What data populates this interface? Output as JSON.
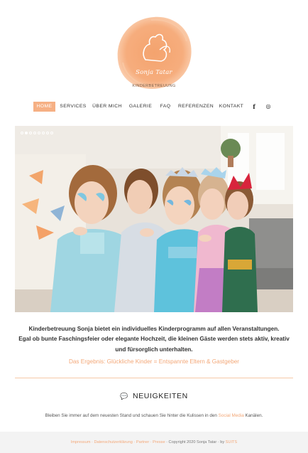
{
  "logo": {
    "script_text": "Sonja Tatar",
    "subtitle": "KINDERBETREUUNG",
    "colors": {
      "blob": "#f6a572",
      "text": "#ffffff"
    }
  },
  "nav": {
    "items": [
      {
        "label": "HOME",
        "active": true
      },
      {
        "label": "SERVICES"
      },
      {
        "label": "ÜBER MICH"
      },
      {
        "label": "GALERIE"
      },
      {
        "label": "FAQ"
      },
      {
        "label": "REFERENZEN"
      },
      {
        "label": "KONTAKT"
      }
    ],
    "social": {
      "facebook": "f",
      "instagram": "◎"
    }
  },
  "slider": {
    "dots": 8,
    "active_dot": 1,
    "image": "children-in-costumes-photo"
  },
  "intro": {
    "line1": "Kinderbetreuung Sonja bietet ein individuelles Kinderprogramm auf allen Veranstaltungen.",
    "line2": "Egal ob bunte Faschingsfeier oder elegante Hochzeit, die kleinen Gäste werden stets aktiv, kreativ",
    "line3": "und fürsorglich unterhalten.",
    "claim": "Das Ergebnis: Glückliche Kinder = Entspannte Eltern & Gastgeber"
  },
  "news": {
    "icon": "chat-icon",
    "title": "NEUIGKEITEN",
    "text_before": "Bleiben Sie immer auf dem neuesten Stand und schauen Sie hinter die Kulissen in den ",
    "link": "Social Media",
    "text_after": " Kanälen."
  },
  "footer": {
    "links": "Impressum · Datenschutzerklärung · Partner · Presse",
    "copyright": " · Copyright 2020 Sonja Tatar · by ",
    "agency": "SUITS"
  },
  "colors": {
    "accent": "#f6b084",
    "accent_text": "#f3a777"
  }
}
